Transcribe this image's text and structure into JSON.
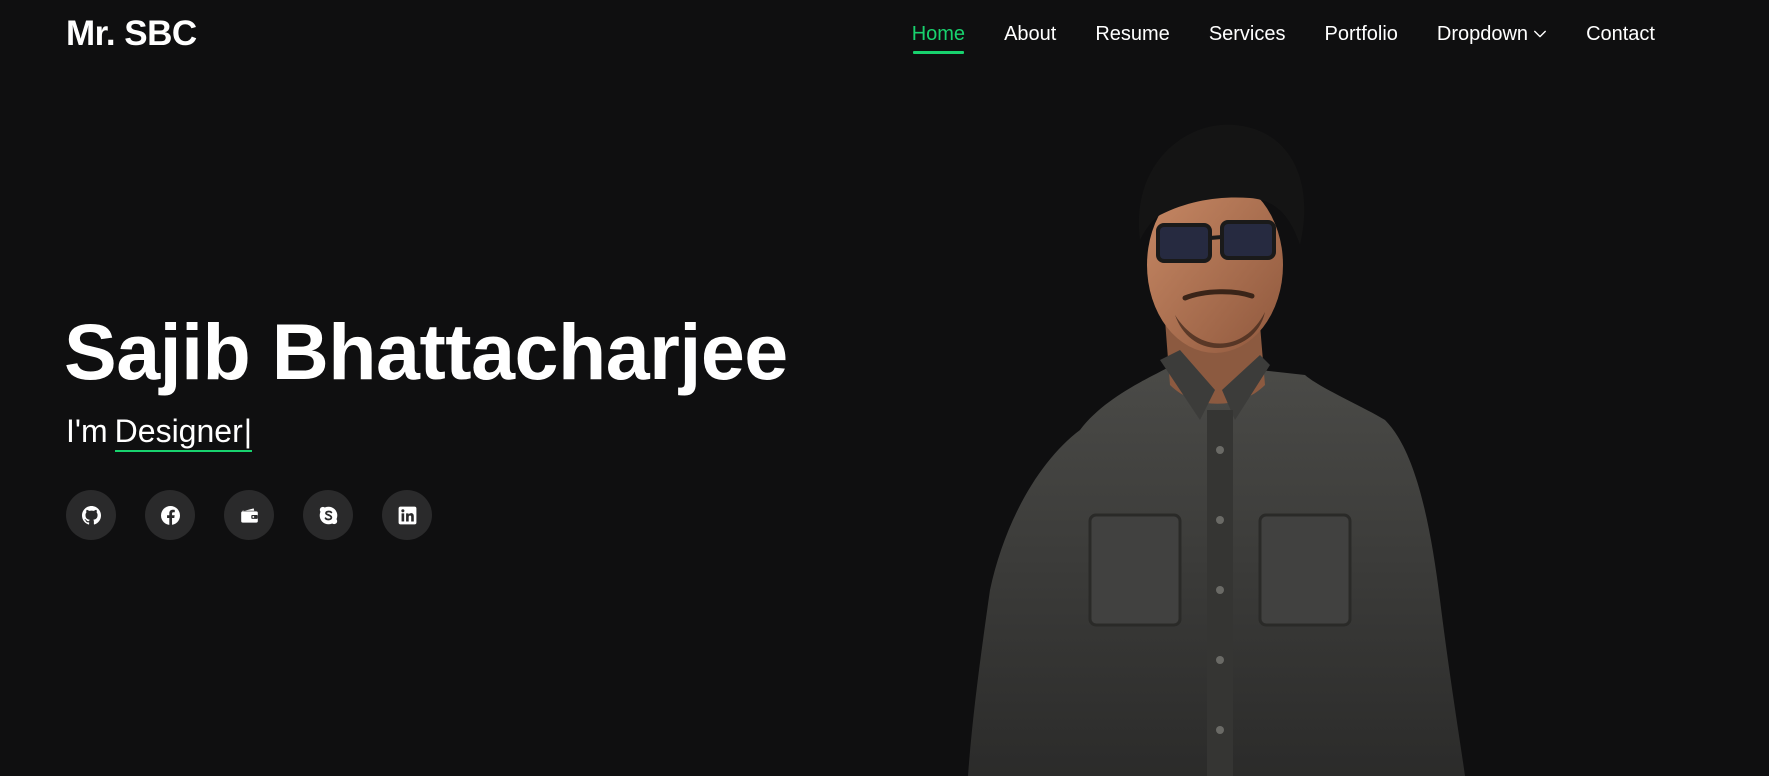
{
  "header": {
    "logo": "Mr. SBC",
    "nav": [
      {
        "label": "Home",
        "active": true
      },
      {
        "label": "About",
        "active": false
      },
      {
        "label": "Resume",
        "active": false
      },
      {
        "label": "Services",
        "active": false
      },
      {
        "label": "Portfolio",
        "active": false
      },
      {
        "label": "Dropdown",
        "active": false,
        "has_dropdown": true
      },
      {
        "label": "Contact",
        "active": false
      }
    ]
  },
  "hero": {
    "name": "Sajib Bhattacharjee",
    "prefix": "I'm",
    "typed_text": "Designer",
    "cursor": "|"
  },
  "socials": [
    {
      "icon": "github-icon"
    },
    {
      "icon": "facebook-icon"
    },
    {
      "icon": "wallet-icon"
    },
    {
      "icon": "skype-icon"
    },
    {
      "icon": "linkedin-icon"
    }
  ],
  "colors": {
    "accent": "#18d26e",
    "background": "#0f0f10",
    "social_bg": "#2a2a2b",
    "text": "#ffffff"
  }
}
